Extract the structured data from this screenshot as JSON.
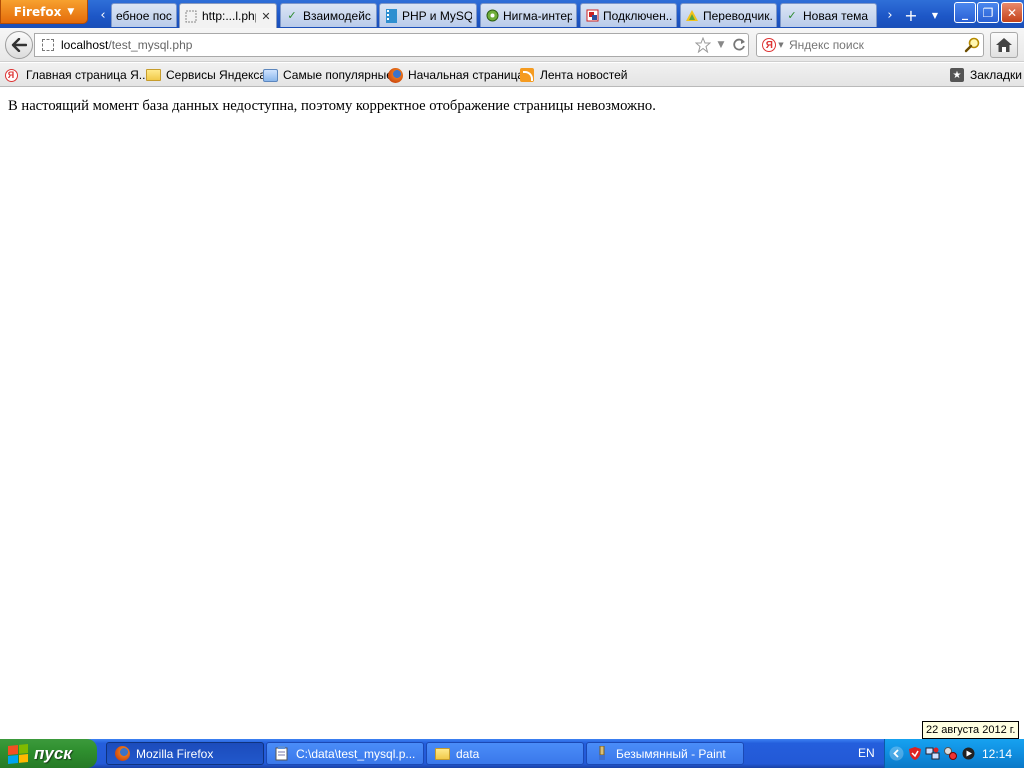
{
  "browser": {
    "menu_button": "Firefox",
    "tabs": [
      {
        "title": "ебное пос...",
        "favicon": "partial-tab-icon"
      },
      {
        "title": "http:...l.php",
        "favicon": "blank-page-icon",
        "active": true
      },
      {
        "title": "Взаимодейс...",
        "favicon": "check-icon"
      },
      {
        "title": "PHP и MySQL...",
        "favicon": "film-icon"
      },
      {
        "title": "Нигма-интер...",
        "favicon": "nigma-icon"
      },
      {
        "title": "Подключен...",
        "favicon": "red-square-icon"
      },
      {
        "title": "Переводчик...",
        "favicon": "translate-icon"
      },
      {
        "title": "Новая тема",
        "favicon": "check-icon"
      }
    ],
    "url": {
      "host": "localhost",
      "path": "/test_mysql.php"
    },
    "search": {
      "placeholder": "Яндекс поиск",
      "engine_letter": "Я"
    },
    "bookmarks": [
      {
        "label": "Главная страница Я...",
        "icon": "yandex-icon"
      },
      {
        "label": "Сервисы Яндекса",
        "icon": "folder-icon"
      },
      {
        "label": "Самые популярные",
        "icon": "popular-icon"
      },
      {
        "label": "Начальная страница",
        "icon": "firefox-icon"
      },
      {
        "label": "Лента новостей",
        "icon": "rss-icon"
      }
    ],
    "bookmarks_menu": "Закладки"
  },
  "page": {
    "message": "В настоящий момент база данных недоступна, поэтому корректное отображение страницы невозможно."
  },
  "taskbar": {
    "start_label": "пуск",
    "tasks": [
      {
        "label": "Mozilla Firefox",
        "icon": "firefox-icon",
        "active": true
      },
      {
        "label": "C:\\data\\test_mysql.p...",
        "icon": "notepad-icon"
      },
      {
        "label": "data",
        "icon": "folder-icon"
      },
      {
        "label": "Безымянный - Paint",
        "icon": "paint-icon"
      }
    ],
    "language": "EN",
    "clock": "12:14",
    "date_tooltip": "22 августа 2012 г."
  }
}
